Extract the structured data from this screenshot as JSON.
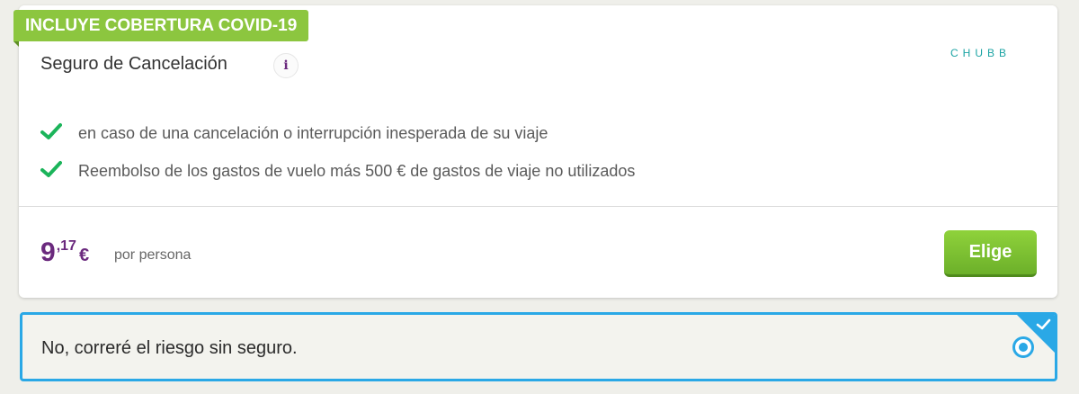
{
  "badge": {
    "text": "INCLUYE COBERTURA COVID-19"
  },
  "insurance": {
    "title": "Seguro de Cancelación",
    "info_icon": "i",
    "provider_logo": "CHUBB",
    "features": [
      "en caso de una cancelación o interrupción inesperada de su viaje",
      "Reembolso de los gastos de vuelo más 500 € de gastos de viaje no utilizados"
    ],
    "price": {
      "integer": "9",
      "decimals": ",17",
      "currency": "€",
      "per": "por persona"
    },
    "choose_label": "Elige"
  },
  "decline_option": {
    "label": "No, correré el riesgo sin seguro.",
    "selected": true
  },
  "icons": {
    "info": "info-icon",
    "check": "check-icon",
    "corner": "selected-corner-check-icon",
    "radio": "radio-selected-icon"
  },
  "colors": {
    "badge_green": "#8cc63f",
    "check_green": "#1bb45a",
    "price_purple": "#6b2a7e",
    "button_green": "#7cc431",
    "selection_blue": "#2aa8e6",
    "logo_teal": "#1aa3a3"
  }
}
